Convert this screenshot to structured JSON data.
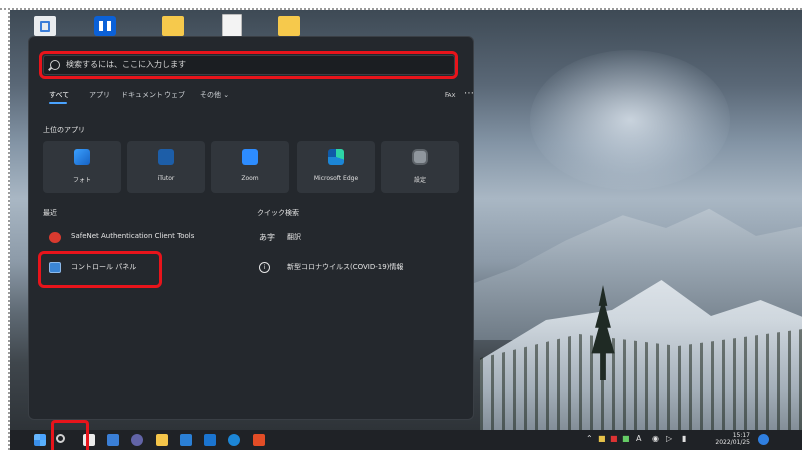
{
  "desktop": {
    "icons": [
      "recycle-bin",
      "dropbox",
      "folder",
      "document",
      "folder"
    ]
  },
  "start_menu": {
    "search": {
      "placeholder": "検索するには、ここに入力します"
    },
    "filters": {
      "all": "すべて",
      "apps": "アプリ",
      "documents": "ドキュメント",
      "web": "ウェブ",
      "more": "その他 ⌄"
    },
    "top_apps_title": "上位のアプリ",
    "top_apps": [
      {
        "label": "フォト",
        "icon": "photos-icon"
      },
      {
        "label": "iTutor",
        "icon": "itutor-icon"
      },
      {
        "label": "Zoom",
        "icon": "zoom-icon"
      },
      {
        "label": "Microsoft Edge",
        "icon": "edge-icon"
      },
      {
        "label": "設定",
        "icon": "settings-icon"
      }
    ],
    "recent_title": "最近",
    "recent": [
      {
        "label": "SafeNet Authentication Client Tools",
        "icon": "safenet-icon"
      },
      {
        "label": "コントロール パネル",
        "icon": "control-panel-icon"
      }
    ],
    "quick_title": "クイック検索",
    "quick": [
      {
        "label": "翻訳",
        "icon_text": "あ字"
      },
      {
        "label": "新型コロナウイルス(COVID-19)情報",
        "icon_text": "i"
      }
    ]
  },
  "taskbar": {
    "clock_time": "15:17",
    "clock_date": "2022/01/25",
    "ime": "A",
    "highlight_color": "#e8141b",
    "accent": "#4aa3ff"
  }
}
